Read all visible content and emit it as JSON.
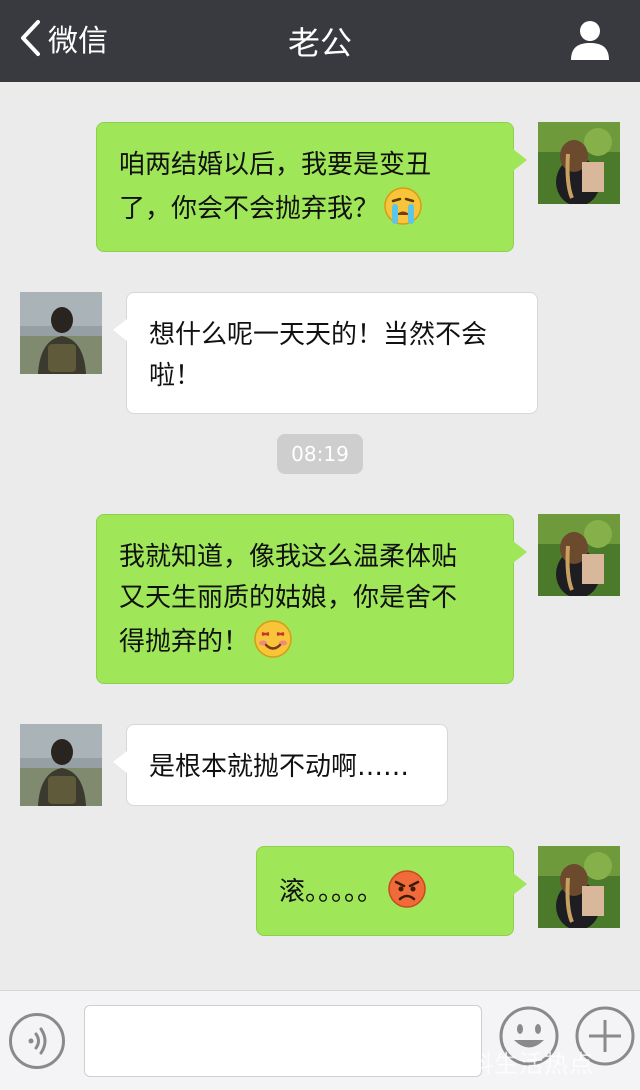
{
  "nav": {
    "back_label": "微信",
    "title": "老公"
  },
  "messages": [
    {
      "side": "out",
      "lines": [
        "咱两结婚以后，我要是变丑",
        "了，你会不会抛弃我？"
      ],
      "emoji": "crying-face-emoji"
    },
    {
      "side": "in",
      "lines": [
        "想什么呢一天天的！当然不会",
        "啦！"
      ]
    },
    {
      "side": "out",
      "lines": [
        "我就知道，像我这么温柔体贴",
        "又天生丽质的姑娘，你是舍不",
        "得抛弃的！"
      ],
      "emoji": "smiling-face-emoji"
    },
    {
      "side": "in",
      "lines": [
        "是根本就抛不动啊……"
      ]
    },
    {
      "side": "out",
      "lines": [
        "滚。。。。。"
      ],
      "emoji": "angry-face-emoji"
    }
  ],
  "timestamp": "08:19",
  "input": {
    "value": "",
    "placeholder": ""
  },
  "watermark": "百家号/有料生活热点",
  "colors": {
    "nav_bg": "#393a3f",
    "chat_bg": "#ebebeb",
    "outgoing_bubble": "#9fe658",
    "incoming_bubble": "#ffffff"
  }
}
